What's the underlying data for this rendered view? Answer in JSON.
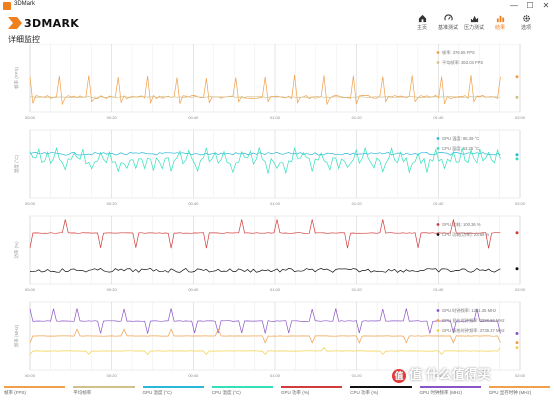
{
  "window": {
    "title": "3DMark",
    "minimize": "—",
    "maximize": "☐",
    "close": "✕"
  },
  "header": {
    "logo": "3DMARK",
    "nav": [
      {
        "label": "主页",
        "icon": "home-icon"
      },
      {
        "label": "基准测试",
        "icon": "gauge-icon"
      },
      {
        "label": "压力测试",
        "icon": "stress-icon"
      },
      {
        "label": "结果",
        "icon": "bar-chart-icon",
        "active": true
      },
      {
        "label": "选项",
        "icon": "gear-icon"
      }
    ],
    "accent": "#f07f1e"
  },
  "page_title": "详细监控",
  "chart_data": [
    {
      "type": "line",
      "ylabel": "帧率 (FPS)",
      "x_ticks": [
        "00:00",
        "00:20",
        "00:40",
        "01:00",
        "01:20",
        "01:40",
        "02:00"
      ],
      "series": [
        {
          "name": "帧率",
          "color": "#f0a04b",
          "legend_value": "376.55 FPS",
          "base": 0.78,
          "spike": 0.3,
          "noise": 0.05,
          "period": 10
        },
        {
          "name": "平均帧率",
          "color": "#d2c08a",
          "legend_value": "363.03 FPS",
          "base": 0.78,
          "spike": 0,
          "noise": 0.015,
          "period": 0
        }
      ]
    },
    {
      "type": "line",
      "ylabel": "温度 (°C)",
      "x_ticks": [
        "00:00",
        "00:20",
        "00:40",
        "01:00",
        "01:20",
        "01:40",
        "02:00"
      ],
      "series": [
        {
          "name": "GPU 温度",
          "color": "#2ab7d9",
          "legend_value": "86.39 °C",
          "base": 0.35,
          "spike": 0,
          "noise": 0.04,
          "period": 0
        },
        {
          "name": "CPU 温度",
          "color": "#33e0bb",
          "legend_value": "53.25 °C",
          "base": 0.45,
          "spike": 0.15,
          "noise": 0.1,
          "period": 3
        }
      ]
    },
    {
      "type": "line",
      "ylabel": "功率 (%)",
      "x_ticks": [
        "00:00",
        "00:20",
        "00:40",
        "01:00",
        "01:20",
        "01:40",
        "02:00"
      ],
      "series": [
        {
          "name": "GPU 功耗",
          "color": "#d23b3b",
          "legend_value": "100.36 %",
          "base": 0.25,
          "spike": 0.22,
          "noise": 0.01,
          "period": 12
        },
        {
          "name": "CPU 功耗(功率)",
          "color": "#111111",
          "legend_value": "23.69 %",
          "base": 0.8,
          "spike": 0.2,
          "noise": 0.06,
          "period": 0
        }
      ]
    },
    {
      "type": "line",
      "ylabel": "频率 (MHz)",
      "x_ticks": [
        "00:00",
        "00:20",
        "00:40",
        "01:00",
        "01:20",
        "01:40",
        "02:00"
      ],
      "series": [
        {
          "name": "GPU 时钟频率",
          "color": "#8a55c7",
          "legend_value": "1351.35 MHz",
          "base": 0.28,
          "spike": 0.18,
          "noise": 0.01,
          "period": 8
        },
        {
          "name": "GPU 显存时钟频率",
          "color": "#f0a04b",
          "legend_value": "2858.66 MHz",
          "base": 0.5,
          "spike": 0.1,
          "noise": 0.005,
          "period": 16
        },
        {
          "name": "GPU 系统时钟频率",
          "color": "#f2d24a",
          "legend_value": "3739.37 MHz",
          "base": 0.72,
          "spike": 0.05,
          "noise": 0.005,
          "period": 20
        }
      ]
    }
  ],
  "legend": [
    {
      "label": "帧率 (FPS)",
      "color": "#f0a04b"
    },
    {
      "label": "平均帧率",
      "color": "#d2c08a"
    },
    {
      "label": "GPU 温度 (°C)",
      "color": "#2ab7d9"
    },
    {
      "label": "CPU 温度 (°C)",
      "color": "#33e0bb"
    },
    {
      "label": "GPU 功率 (%)",
      "color": "#d23b3b"
    },
    {
      "label": "CPU 功率 (%)",
      "color": "#111111"
    },
    {
      "label": "GPU 时钟频率 (MHz)",
      "color": "#8a55c7"
    },
    {
      "label": "GPU 显存时钟 (MHz)",
      "color": "#f0a04b"
    }
  ],
  "watermark": "值 什么值得买"
}
